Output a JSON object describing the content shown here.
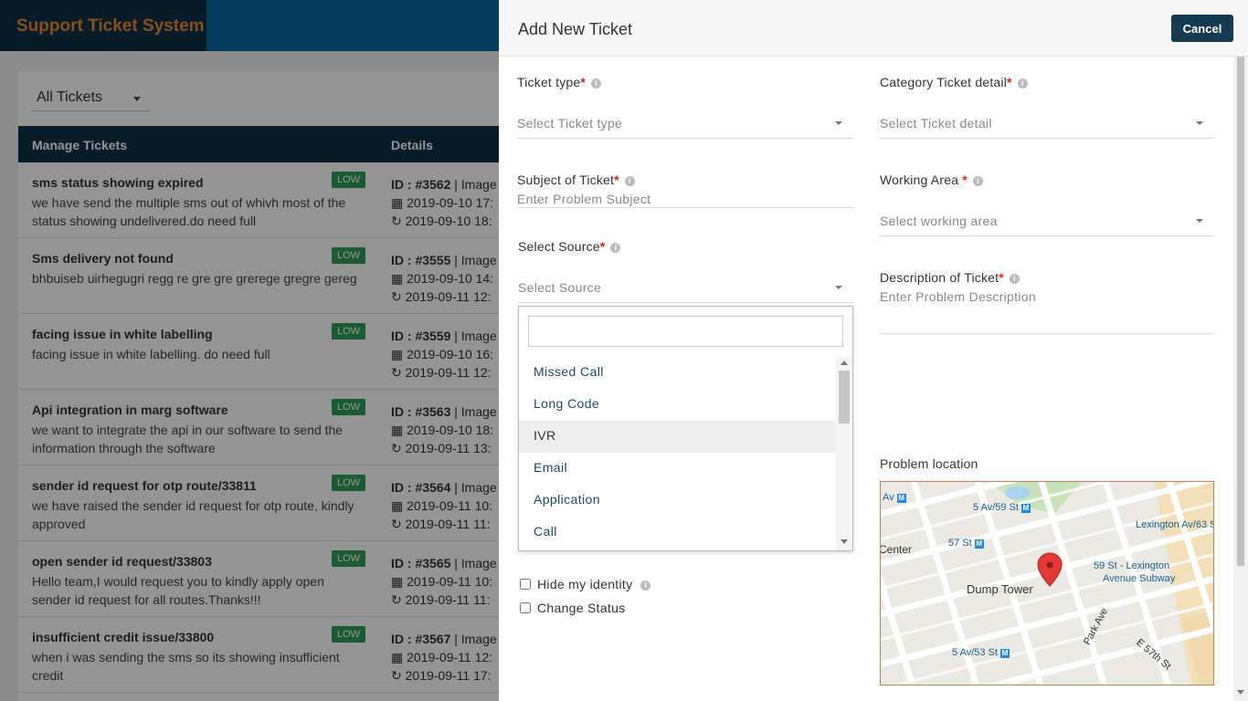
{
  "app": {
    "brand": "Support Ticket System",
    "filter": "All Tickets",
    "columns": {
      "manage": "Manage Tickets",
      "details": "Details"
    },
    "tickets": [
      {
        "subject": "sms status showing expired",
        "badge": "LOW",
        "desc": "we have send the multiple sms out of whivh most of the status showing undelivered.do need full",
        "id": "ID : #3562",
        "extra": " | Image",
        "date1": "2019-09-10 17:",
        "date2": "2019-09-10 18:"
      },
      {
        "subject": "Sms delivery not found",
        "badge": "LOW",
        "desc": "bhbuiseb uirhegugri regg re gre gre grerege gregre gereg",
        "id": "ID : #3555",
        "extra": " | Image",
        "date1": "2019-09-10 14:",
        "date2": "2019-09-11 12:"
      },
      {
        "subject": "facing issue in white labelling",
        "badge": "LOW",
        "desc": "facing issue in white labelling. do need full",
        "id": "ID : #3559",
        "extra": " | Image",
        "date1": "2019-09-10 16:",
        "date2": "2019-09-11 12:"
      },
      {
        "subject": "Api integration in marg software",
        "badge": "LOW",
        "desc": "we want to integrate the api in our software to send the information through the software",
        "id": "ID : #3563",
        "extra": " | Image",
        "date1": "2019-09-10 18:",
        "date2": "2019-09-11 13:"
      },
      {
        "subject": "sender id request for otp route/33811",
        "badge": "LOW",
        "desc": "we have raised the sender id request for otp route, kindly approved",
        "id": "ID : #3564",
        "extra": " | Image",
        "date1": "2019-09-11 10:",
        "date2": "2019-09-11 11:"
      },
      {
        "subject": "open sender id request/33803",
        "badge": "LOW",
        "desc": "Hello team,I would request you to kindly apply open sender id request for all routes.Thanks!!!",
        "id": "ID : #3565",
        "extra": " | Image",
        "date1": "2019-09-11 10:",
        "date2": "2019-09-11 11:"
      },
      {
        "subject": "insufficient credit issue/33800",
        "badge": "LOW",
        "desc": "when i was sending the sms  so its showing insufficient credit",
        "id": "ID : #3567",
        "extra": " | Image",
        "date1": "2019-09-11 12:",
        "date2": "2019-09-11 17:"
      }
    ]
  },
  "panel": {
    "title": "Add New Ticket",
    "cancel_label": "Cancel",
    "ticket_type": {
      "label": "Ticket type",
      "placeholder": "Select Ticket type"
    },
    "category": {
      "label": "Category Ticket detail",
      "placeholder": "Select Ticket detail"
    },
    "subject": {
      "label": "Subject of Ticket",
      "placeholder": "Enter Problem Subject"
    },
    "working_area": {
      "label": "Working Area ",
      "placeholder": "Select working area"
    },
    "source": {
      "label": "Select Source",
      "placeholder": "Select Source"
    },
    "description": {
      "label": "Description of Ticket",
      "placeholder": "Enter Problem Description"
    },
    "source_options": [
      "Missed Call",
      "Long Code",
      "IVR",
      "Email",
      "Application",
      "Call"
    ],
    "highlighted_option": "IVR",
    "hide_identity": "Hide my identity",
    "change_status": "Change Status",
    "problem_location": "Problem location",
    "map_labels": {
      "av_m": "Av",
      "fifth_59": "5 Av/59 St",
      "lex_63": "Lexington Av/63 St",
      "center": "Center",
      "st57": "57 St",
      "lex_59a": "59 St - Lexington",
      "lex_59b": "Avenue Subway",
      "dump": "Dump Tower",
      "park": "Park Ave",
      "e57": "E 57th St",
      "fifth_53": "5 Av/53 St",
      "subway_glyph": "M"
    }
  },
  "colors": {
    "brand": "#e8892e",
    "header": "#0b6aa3",
    "dark": "#0f2f45",
    "badge": "#2e9d5a",
    "required": "#e02020",
    "pin": "#e53935"
  }
}
